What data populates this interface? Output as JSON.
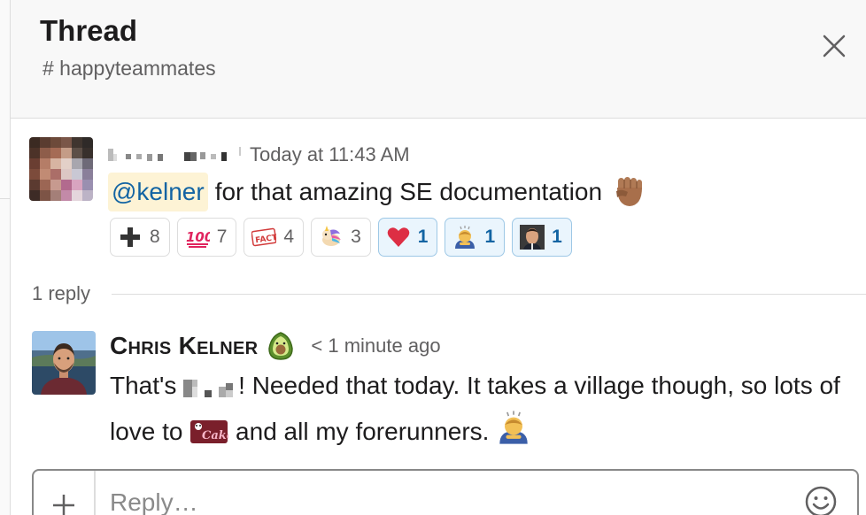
{
  "header": {
    "title": "Thread",
    "channel": "# happyteammates"
  },
  "parent_message": {
    "timestamp": "Today at 11:43 AM",
    "mention": "@kelner",
    "text": "for that amazing SE documentation"
  },
  "reactions": [
    {
      "icon": "plus-emoji",
      "count": "8",
      "mine": false
    },
    {
      "icon": "hundred-emoji",
      "count": "7",
      "mine": false
    },
    {
      "icon": "fact-emoji",
      "count": "4",
      "mine": false
    },
    {
      "icon": "unicorn-dog-emoji",
      "count": "3",
      "mine": false
    },
    {
      "icon": "heart-emoji",
      "count": "1",
      "mine": true
    },
    {
      "icon": "bowing-person-emoji",
      "count": "1",
      "mine": true
    },
    {
      "icon": "face-photo-emoji",
      "count": "1",
      "mine": true
    }
  ],
  "reply_divider": {
    "count_label": "1 reply"
  },
  "reply_message": {
    "author": "Chris Kelner",
    "time": "< 1 minute ago",
    "text_part1": "That's ",
    "text_part2": "! Needed that today. It takes a village though, so lots of love to ",
    "text_part3": " and all my forerunners. "
  },
  "composer": {
    "placeholder": "Reply…"
  },
  "colors": {
    "link_blue": "#1264a3",
    "mention_bg": "#fdf3d5",
    "reaction_active_bg": "#eaf5fd"
  }
}
